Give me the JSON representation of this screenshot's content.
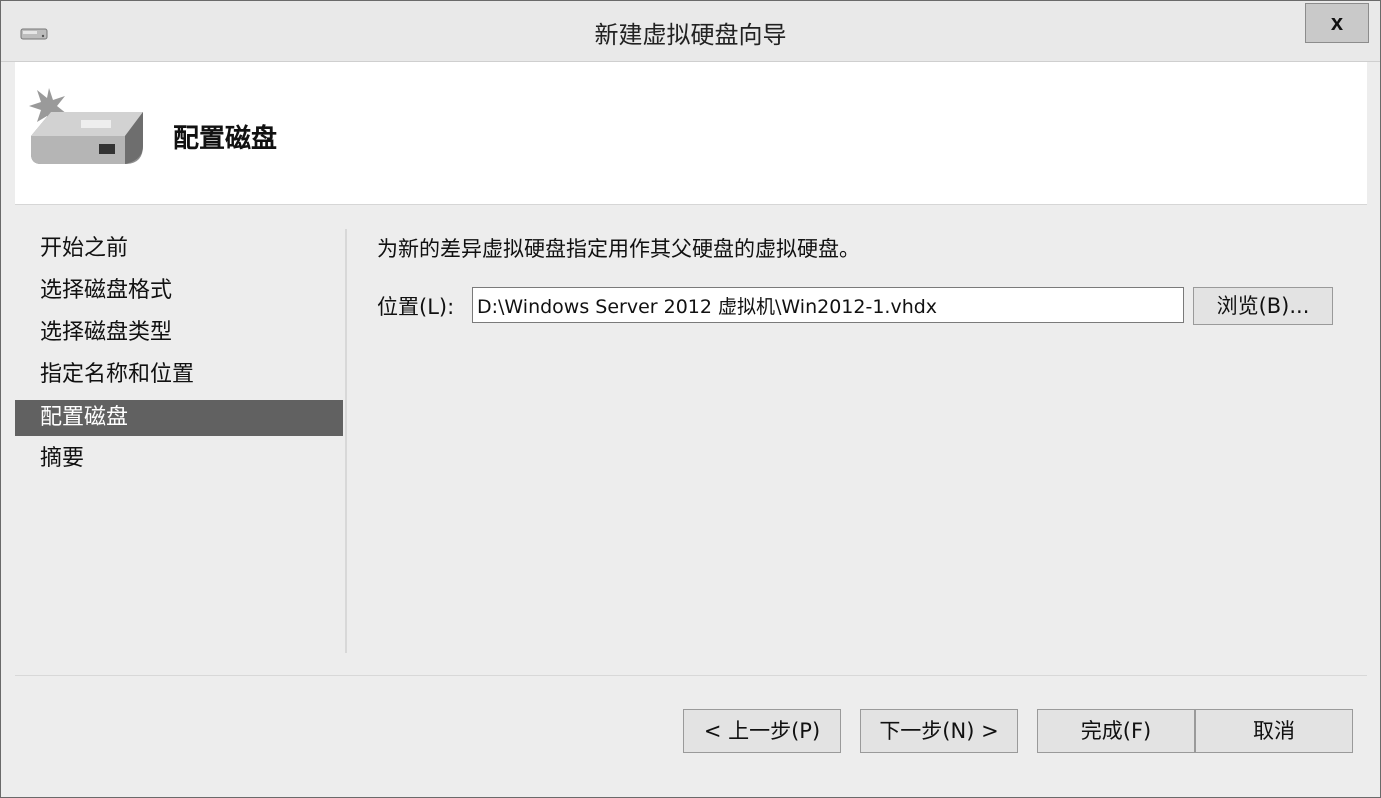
{
  "window": {
    "title": "新建虚拟硬盘向导",
    "close_label": "x"
  },
  "header": {
    "title": "配置磁盘",
    "icon": "hard-disk-new-icon"
  },
  "nav": {
    "items": [
      {
        "label": "开始之前",
        "active": false
      },
      {
        "label": "选择磁盘格式",
        "active": false
      },
      {
        "label": "选择磁盘类型",
        "active": false
      },
      {
        "label": "指定名称和位置",
        "active": false
      },
      {
        "label": "配置磁盘",
        "active": true
      },
      {
        "label": "摘要",
        "active": false
      }
    ]
  },
  "content": {
    "instruction": "为新的差异虚拟硬盘指定用作其父硬盘的虚拟硬盘。",
    "location_label": "位置(L):",
    "location_value": "D:\\Windows Server 2012 虚拟机\\Win2012-1.vhdx",
    "browse_label": "浏览(B)..."
  },
  "footer": {
    "prev_label": "< 上一步(P)",
    "next_label": "下一步(N) >",
    "finish_label": "完成(F)",
    "cancel_label": "取消"
  },
  "colors": {
    "selected_nav_bg": "#616161",
    "window_bg": "#ededed",
    "header_bg": "#ffffff"
  }
}
